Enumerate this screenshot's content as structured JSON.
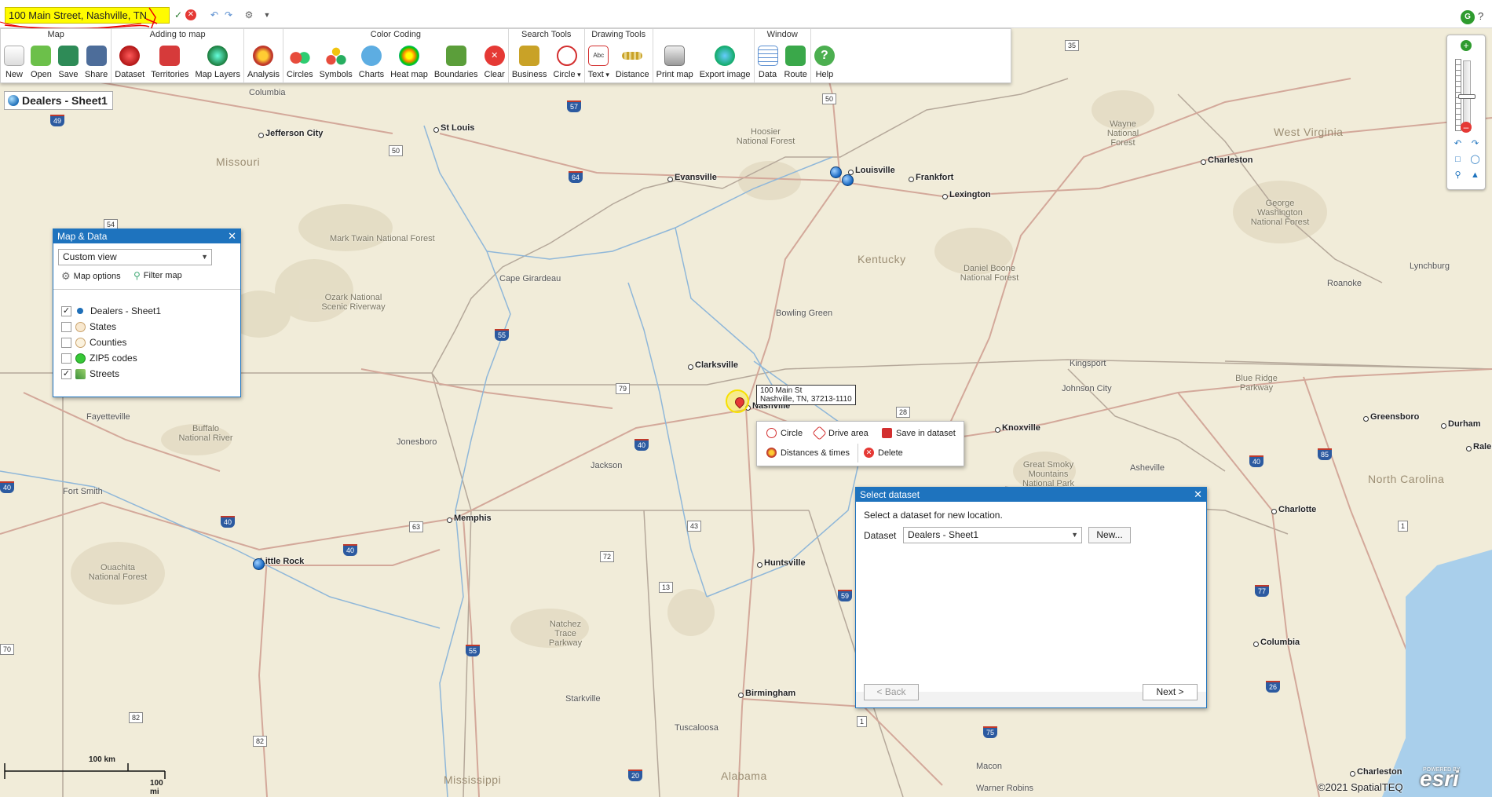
{
  "topbar": {
    "search_value": "100 Main Street, Nashville, TN",
    "avatar_initial": "G",
    "help_glyph": "?"
  },
  "ribbon": {
    "groups": [
      {
        "title": "Map",
        "buttons": [
          "New",
          "Open",
          "Save",
          "Share"
        ]
      },
      {
        "title": "Adding to map",
        "buttons": [
          "Dataset",
          "Territories",
          "Map Layers"
        ]
      },
      {
        "title": "",
        "buttons": [
          "Analysis"
        ]
      },
      {
        "title": "Color Coding",
        "buttons": [
          "Circles",
          "Symbols",
          "Charts",
          "Heat map",
          "Boundaries",
          "Clear"
        ]
      },
      {
        "title": "Search Tools",
        "buttons": [
          "Business",
          "Circle"
        ]
      },
      {
        "title": "Drawing Tools",
        "buttons": [
          "Text",
          "Distance"
        ]
      },
      {
        "title": "",
        "buttons": [
          "Print map",
          "Export image"
        ]
      },
      {
        "title": "Window",
        "buttons": [
          "Data",
          "Route"
        ]
      },
      {
        "title": "",
        "buttons": [
          "Help"
        ]
      }
    ]
  },
  "layer_badge": "Dealers - Sheet1",
  "map_data_panel": {
    "title": "Map & Data",
    "view_select": "Custom view",
    "map_options": "Map options",
    "filter_map": "Filter map",
    "layers": [
      {
        "label": "Dealers - Sheet1",
        "checked": true,
        "color": "#1f6fb8"
      },
      {
        "label": "States",
        "checked": false,
        "color": "#f5deb3"
      },
      {
        "label": "Counties",
        "checked": false,
        "color": "#f8ecd2"
      },
      {
        "label": "ZIP5 codes",
        "checked": false,
        "color": "#37c837"
      },
      {
        "label": "Streets",
        "checked": true,
        "color": "#3a8f3a"
      }
    ]
  },
  "address_tip": {
    "line1": "100 Main St",
    "line2": "Nashville, TN, 37213-1110"
  },
  "context_menu": {
    "circle": "Circle",
    "drive_area": "Drive area",
    "save_in_dataset": "Save in dataset",
    "distances_times": "Distances & times",
    "delete": "Delete"
  },
  "select_dataset": {
    "title": "Select dataset",
    "instruction": "Select a dataset for new location.",
    "dataset_label": "Dataset",
    "dataset_value": "Dealers - Sheet1",
    "new_button": "New...",
    "back_button": "< Back",
    "next_button": "Next >"
  },
  "map": {
    "cities": [
      "Columbia",
      "Jefferson City",
      "St Louis",
      "Louisville",
      "Frankfort",
      "Lexington",
      "Charleston",
      "Evansville",
      "Clarksville",
      "Nashville",
      "Knoxville",
      "Memphis",
      "Little Rock",
      "Huntsville",
      "Birmingham",
      "Fayetteville",
      "Fort Smith",
      "Greensboro",
      "Durham",
      "Raleigh",
      "Charlotte",
      "Columbia",
      "Jackson",
      "Jonesboro",
      "Bowling Green",
      "Cape Girardeau",
      "Kingsport",
      "Johnson City",
      "Asheville",
      "Roanoke",
      "Lynchburg",
      "Tuscaloosa",
      "Starkville",
      "Macon",
      "Charleston",
      "Warner Robins"
    ],
    "states": [
      "Missouri",
      "Kentucky",
      "West Virginia",
      "North Carolina",
      "Mississippi",
      "Alabama"
    ],
    "forests": [
      "Mark Twain National Forest",
      "Ozark National Scenic Riverway",
      "Hoosier National Forest",
      "Daniel Boone National Forest",
      "Wayne National Forest",
      "George Washington National Forest",
      "Blue Ridge Parkway",
      "Great Smoky Mountains National Park",
      "Buffalo National River",
      "Ouachita National Forest",
      "Natchez Trace Parkway"
    ],
    "scale_km": "100 km",
    "scale_mi": "100 mi",
    "copyright": "©2021 SpatialTEQ",
    "esri": "esri",
    "esri_small": "POWERED BY"
  }
}
